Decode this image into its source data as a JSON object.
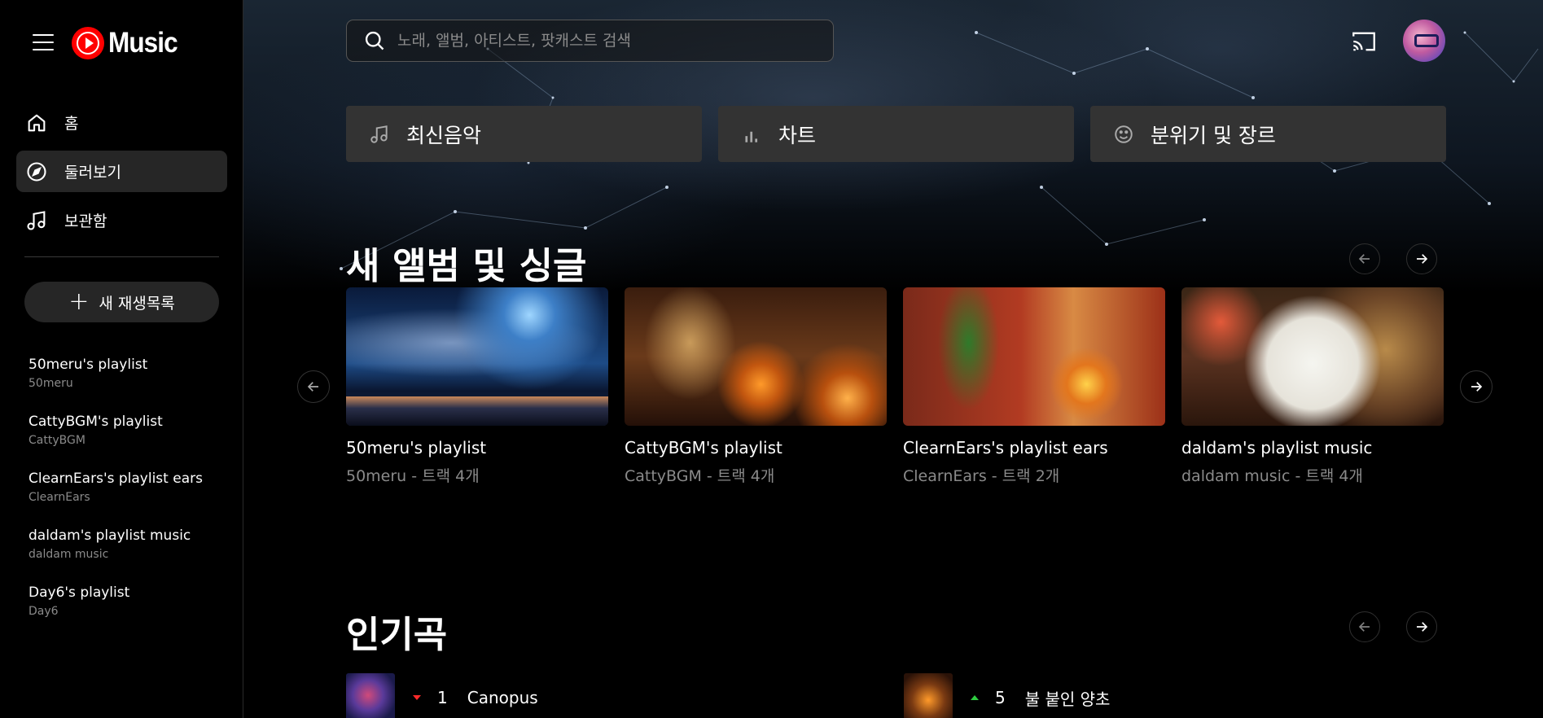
{
  "app": {
    "logo_text": "Music"
  },
  "sidebar": {
    "nav": [
      {
        "label": "홈",
        "icon": "home-icon"
      },
      {
        "label": "둘러보기",
        "icon": "compass-icon",
        "active": true
      },
      {
        "label": "보관함",
        "icon": "music-note-icon"
      }
    ],
    "new_playlist_label": "새 재생목록",
    "playlists": [
      {
        "title": "50meru's playlist",
        "owner": "50meru"
      },
      {
        "title": "CattyBGM's playlist",
        "owner": "CattyBGM"
      },
      {
        "title": "ClearnEars's playlist ears",
        "owner": "ClearnEars"
      },
      {
        "title": "daldam's playlist music",
        "owner": "daldam music"
      },
      {
        "title": "Day6's playlist",
        "owner": "Day6"
      }
    ]
  },
  "search": {
    "placeholder": "노래, 앨범, 아티스트, 팟캐스트 검색"
  },
  "chips": [
    {
      "label": "최신음악",
      "icon": "music-note-icon"
    },
    {
      "label": "차트",
      "icon": "bar-chart-icon"
    },
    {
      "label": "분위기 및 장르",
      "icon": "smile-icon"
    }
  ],
  "new_releases": {
    "title": "새 앨범 및 싱글",
    "cards": [
      {
        "title": "50meru's playlist",
        "subtitle": "50meru - 트랙 4개"
      },
      {
        "title": "CattyBGM's playlist",
        "subtitle": "CattyBGM - 트랙 4개"
      },
      {
        "title": "ClearnEars's playlist ears",
        "subtitle": "ClearnEars - 트랙 2개"
      },
      {
        "title": "daldam's playlist music",
        "subtitle": "daldam music - 트랙 4개"
      }
    ]
  },
  "popular": {
    "title": "인기곡",
    "rows": [
      {
        "rank": "1",
        "song": "Canopus",
        "trend": "down"
      },
      {
        "rank": "5",
        "song": "불 붙인 양초",
        "trend": "up"
      }
    ]
  },
  "colors": {
    "accent": "#ff0000",
    "background": "#000000",
    "chip": "#333333",
    "trend_down": "#ff2a2a",
    "trend_up": "#2ecc40"
  }
}
